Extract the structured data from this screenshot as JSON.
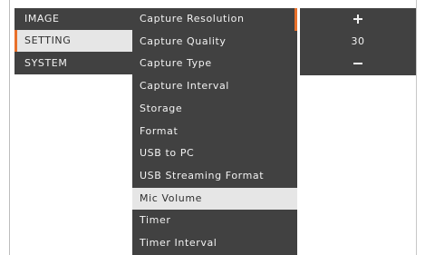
{
  "categories": [
    {
      "label": "IMAGE"
    },
    {
      "label": "SETTING"
    },
    {
      "label": "SYSTEM"
    }
  ],
  "selected_category": "SETTING",
  "settings": [
    {
      "label": "Capture Resolution"
    },
    {
      "label": "Capture Quality"
    },
    {
      "label": "Capture Type"
    },
    {
      "label": "Capture Interval"
    },
    {
      "label": "Storage"
    },
    {
      "label": "Format"
    },
    {
      "label": "USB to PC"
    },
    {
      "label": "USB Streaming Format"
    },
    {
      "label": "Mic Volume"
    },
    {
      "label": "Timer"
    },
    {
      "label": "Timer Interval"
    }
  ],
  "selected_setting": "Mic Volume",
  "value_panel": {
    "increase_icon": "plus-icon",
    "value": "30",
    "decrease_icon": "minus-icon"
  },
  "colors": {
    "menu_background": "#414141",
    "selected_background": "#e6e6e6",
    "accent": "#e8702a",
    "text": "#f2f2f2",
    "selected_text": "#2e2e2e"
  }
}
